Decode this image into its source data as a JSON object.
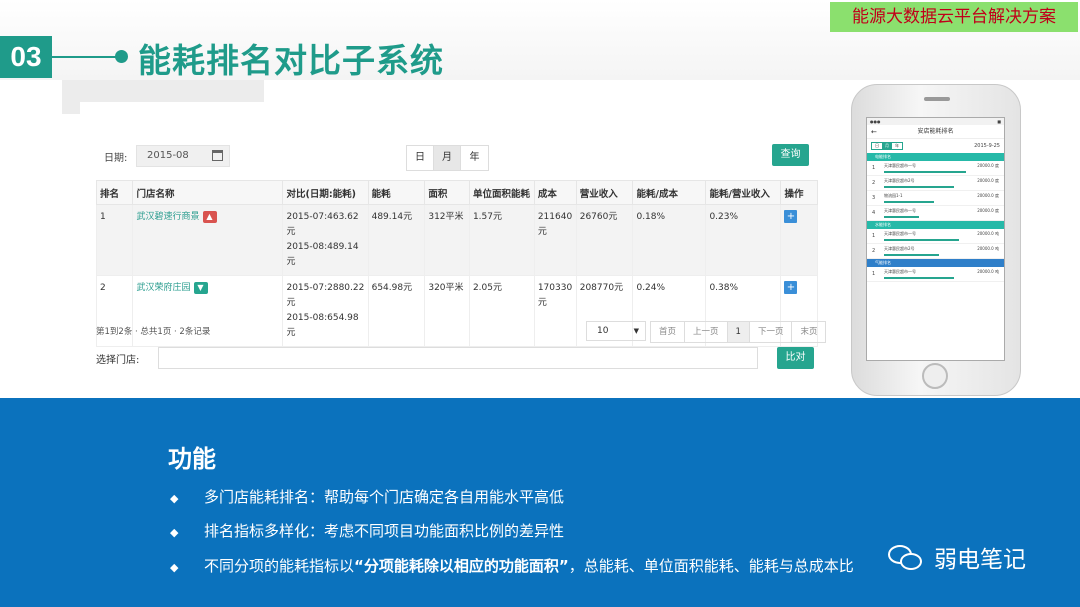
{
  "header": {
    "brand": "能源大数据云平台解决方案",
    "section_number": "03",
    "section_title": "能耗排名对比子系统"
  },
  "app": {
    "date_label": "日期:",
    "date_value": "2015-08",
    "period_tabs": [
      "日",
      "月",
      "年"
    ],
    "active_period": "月",
    "query_label": "查询",
    "columns": [
      "排名",
      "门店名称",
      "对比(日期:能耗)",
      "能耗",
      "面积",
      "单位面积能耗",
      "成本",
      "营业收入",
      "能耗/成本",
      "能耗/营业收入",
      "操作"
    ],
    "rows": [
      {
        "rank": "1",
        "store": "武汉碧速行商景",
        "trend": "up",
        "compare_1": "2015-07:463.62元",
        "compare_2": "2015-08:489.14元",
        "energy": "489.14元",
        "area": "312平米",
        "unit_energy": "1.57元",
        "cost": "211640元",
        "revenue": "26760元",
        "energy_cost": "0.18%",
        "energy_revenue": "0.23%"
      },
      {
        "rank": "2",
        "store": "武汉荣府庄园",
        "trend": "down",
        "compare_1": "2015-07:2880.22元",
        "compare_2": "2015-08:654.98元",
        "energy": "654.98元",
        "area": "320平米",
        "unit_energy": "2.05元",
        "cost": "170330元",
        "revenue": "208770元",
        "energy_cost": "0.24%",
        "energy_revenue": "0.38%"
      }
    ],
    "page_info": "第1到2条 · 总共1页 · 2条记录",
    "page_size": "10",
    "pager": [
      "首页",
      "上一页",
      "1",
      "下一页",
      "末页"
    ],
    "store_label": "选择门店:",
    "compare_label": "比对"
  },
  "phone": {
    "title": "安店能耗排名",
    "segment": [
      "日",
      "月",
      "年"
    ],
    "date": "2015-9-25",
    "groups": [
      {
        "name": "电能排名",
        "color": "#26b9a8",
        "items": [
          {
            "n": "1",
            "name": "天津惠民超市一号",
            "value": "20000.0 度",
            "bar": 0.82
          },
          {
            "n": "2",
            "name": "天津惠民超市2号",
            "value": "20000.0 度",
            "bar": 0.7
          },
          {
            "n": "3",
            "name": "物流园1-1",
            "value": "20000.0 度",
            "bar": 0.5
          },
          {
            "n": "4",
            "name": "天津惠民超市一号",
            "value": "20000.0 度",
            "bar": 0.35
          }
        ]
      },
      {
        "name": "水能排名",
        "color": "#26b9a8",
        "items": [
          {
            "n": "1",
            "name": "天津惠民超市一号",
            "value": "20000.0 吨",
            "bar": 0.75
          },
          {
            "n": "2",
            "name": "天津惠民超市2号",
            "value": "20000.0 吨",
            "bar": 0.55
          }
        ]
      },
      {
        "name": "气能排名",
        "color": "#2f7fc9",
        "items": [
          {
            "n": "1",
            "name": "天津惠民超市一号",
            "value": "20000.0 吨",
            "bar": 0.7
          }
        ]
      }
    ]
  },
  "features": {
    "title": "功能",
    "items": [
      "多门店能耗排名：帮助每个门店确定各自用能水平高低",
      "排名指标多样化：考虑不同项目功能面积比例的差异性"
    ],
    "item3_prefix": "不同分项的能耗指标以",
    "item3_highlight": "“分项能耗除以相应的功能面积”",
    "item3_suffix": "，总能耗、单位面积能耗、能耗与总成本比"
  },
  "watermark": "弱电笔记"
}
